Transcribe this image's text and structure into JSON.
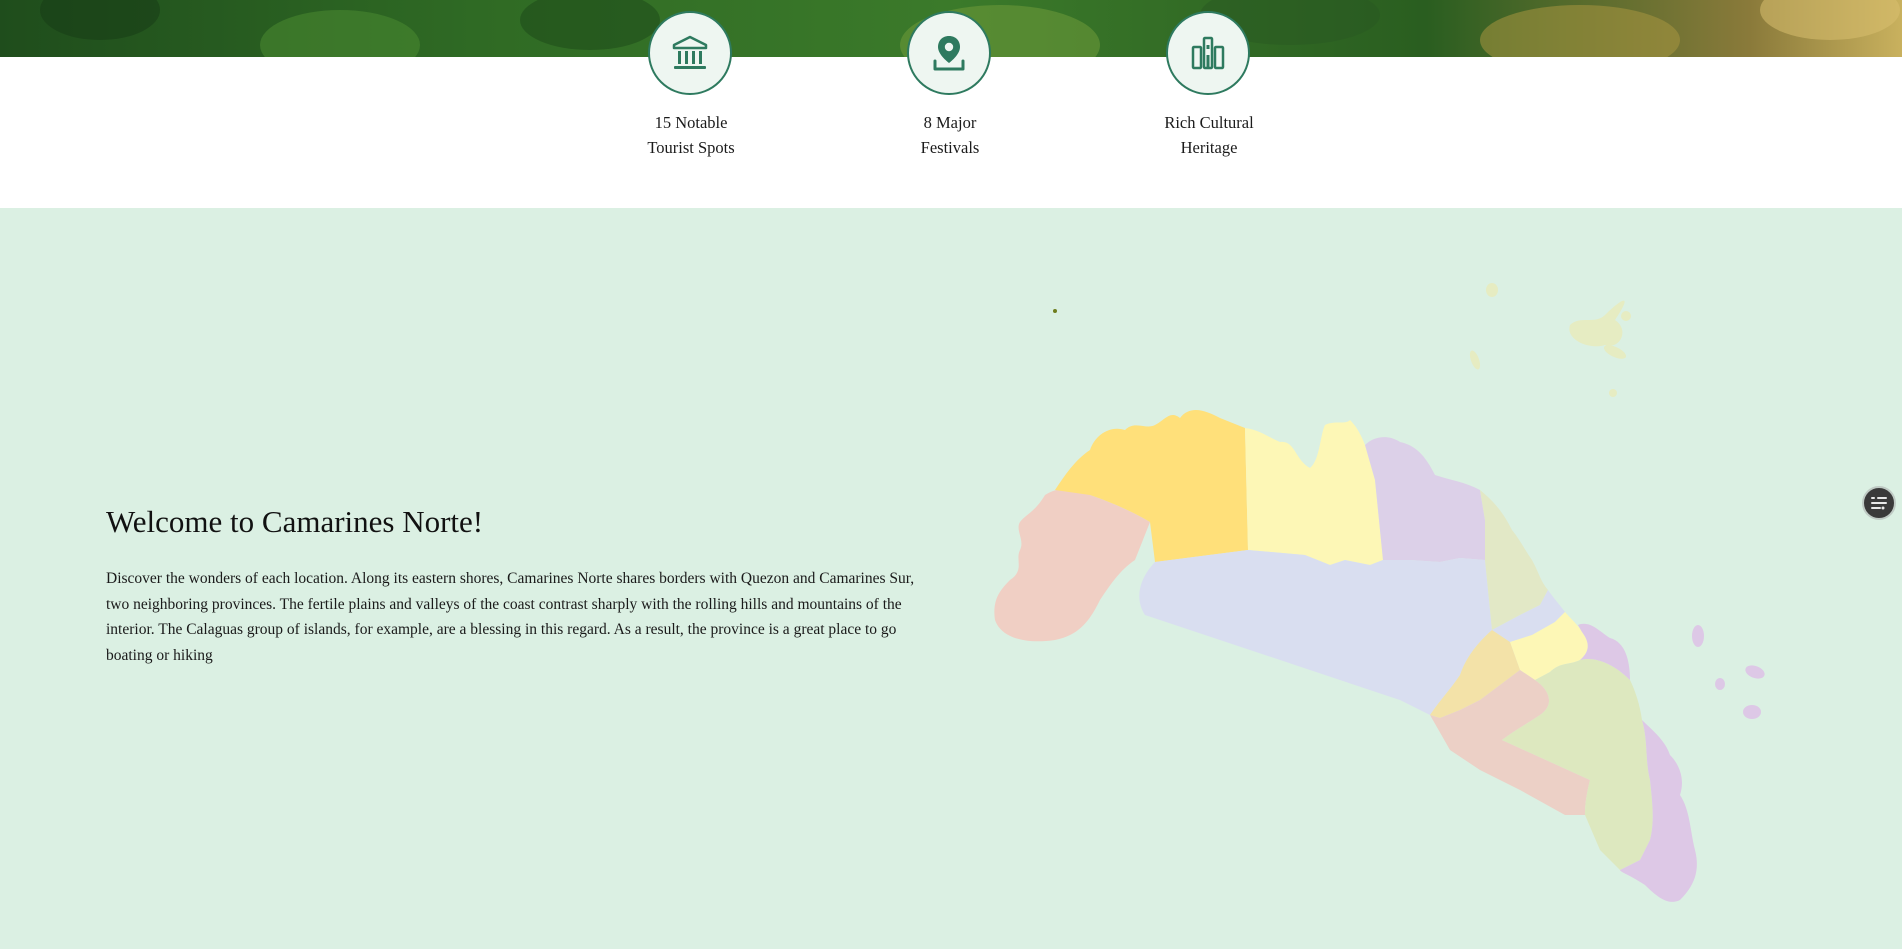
{
  "stats": [
    {
      "icon": "museum-icon",
      "line1": "15 Notable",
      "line2": "Tourist Spots"
    },
    {
      "icon": "location-pin-icon",
      "line1": "8 Major",
      "line2": "Festivals"
    },
    {
      "icon": "heritage-building-icon",
      "line1": "Rich Cultural",
      "line2": "Heritage"
    }
  ],
  "welcome": {
    "title": "Welcome to Camarines Norte!",
    "body": "Discover the wonders of each location. Along its eastern shores, Camarines Norte shares borders with Quezon and Camarines Sur, two neighboring provinces. The fertile plains and valleys of the coast contrast sharply with the rolling hills and mountains of the interior. The Calaguas group of islands, for example, are a blessing in this regard. As a result, the province is a great place to go boating or hiking"
  },
  "colors": {
    "accent": "#2e7a5f",
    "band_bg": "#dbf0e3",
    "map_regions": [
      "#f0cfc4",
      "#ffe07a",
      "#fdf7b6",
      "#dcd0e8",
      "#d9def0",
      "#e2e8c6",
      "#f3e2a8",
      "#ecd0c6",
      "#dde8bf",
      "#ddc8e6"
    ]
  },
  "fab": {
    "icon": "filter-list-icon"
  }
}
